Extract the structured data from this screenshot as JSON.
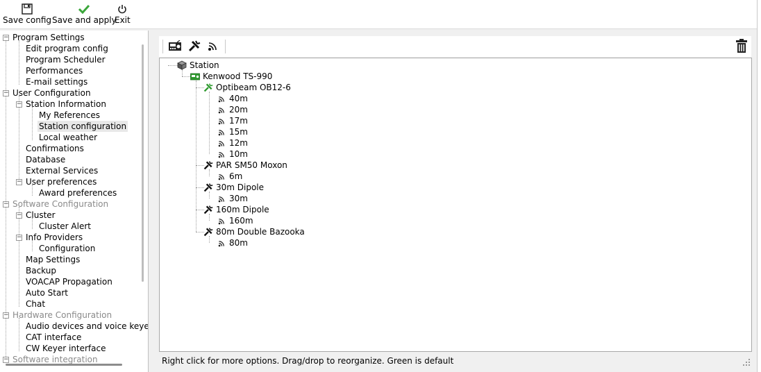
{
  "toolbar": {
    "buttons": [
      {
        "label": "Save config",
        "icon": "floppy-disk-icon"
      },
      {
        "label": "Save and apply",
        "icon": "green-checkmark-icon"
      },
      {
        "label": "Exit",
        "icon": "power-icon"
      }
    ]
  },
  "nav": {
    "items": [
      {
        "label": "Program Settings"
      },
      {
        "label": "Edit program config"
      },
      {
        "label": "Program Scheduler"
      },
      {
        "label": "Performances"
      },
      {
        "label": "E-mail settings"
      },
      {
        "label": "User Configuration"
      },
      {
        "label": "Station Information"
      },
      {
        "label": "My References"
      },
      {
        "label": "Station configuration"
      },
      {
        "label": "Local weather"
      },
      {
        "label": "Confirmations"
      },
      {
        "label": "Database"
      },
      {
        "label": "External Services"
      },
      {
        "label": "User preferences"
      },
      {
        "label": "Award preferences"
      },
      {
        "label": "Software Configuration"
      },
      {
        "label": "Cluster"
      },
      {
        "label": "Cluster Alert"
      },
      {
        "label": "Info Providers"
      },
      {
        "label": "Configuration"
      },
      {
        "label": "Map Settings"
      },
      {
        "label": "Backup"
      },
      {
        "label": "VOACAP Propagation"
      },
      {
        "label": "Auto Start"
      },
      {
        "label": "Chat"
      },
      {
        "label": "Hardware Configuration"
      },
      {
        "label": "Audio devices and voice keyer"
      },
      {
        "label": "CAT interface"
      },
      {
        "label": "CW Keyer interface"
      },
      {
        "label": "Software integration"
      }
    ]
  },
  "main_toolbar": {
    "icons": [
      "radio-icon",
      "antenna-icon",
      "band-signal-icon",
      "trash-icon"
    ]
  },
  "station_tree": {
    "nodes": [
      {
        "label": "Station",
        "icon": "station-icon"
      },
      {
        "label": "Kenwood TS-990",
        "icon": "radio-icon"
      },
      {
        "label": "Optibeam OB12-6",
        "icon": "antenna-icon"
      },
      {
        "label": "40m",
        "icon": "band-signal-icon"
      },
      {
        "label": "20m",
        "icon": "band-signal-icon"
      },
      {
        "label": "17m",
        "icon": "band-signal-icon"
      },
      {
        "label": "15m",
        "icon": "band-signal-icon"
      },
      {
        "label": "12m",
        "icon": "band-signal-icon"
      },
      {
        "label": "10m",
        "icon": "band-signal-icon"
      },
      {
        "label": "PAR SM50 Moxon",
        "icon": "antenna-icon"
      },
      {
        "label": "6m",
        "icon": "band-signal-icon"
      },
      {
        "label": "30m Dipole",
        "icon": "antenna-icon"
      },
      {
        "label": "30m",
        "icon": "band-signal-icon"
      },
      {
        "label": "160m Dipole",
        "icon": "antenna-icon"
      },
      {
        "label": "160m",
        "icon": "band-signal-icon"
      },
      {
        "label": "80m Double Bazooka",
        "icon": "antenna-icon"
      },
      {
        "label": "80m",
        "icon": "band-signal-icon"
      }
    ]
  },
  "status_bar": {
    "text": "Right click for more options. Drag/drop to reorganize. Green is default"
  },
  "colors": {
    "default_green": "#2e9a2e",
    "disabled_grey": "#8a8a8a",
    "selection": "#e8e8e8"
  }
}
